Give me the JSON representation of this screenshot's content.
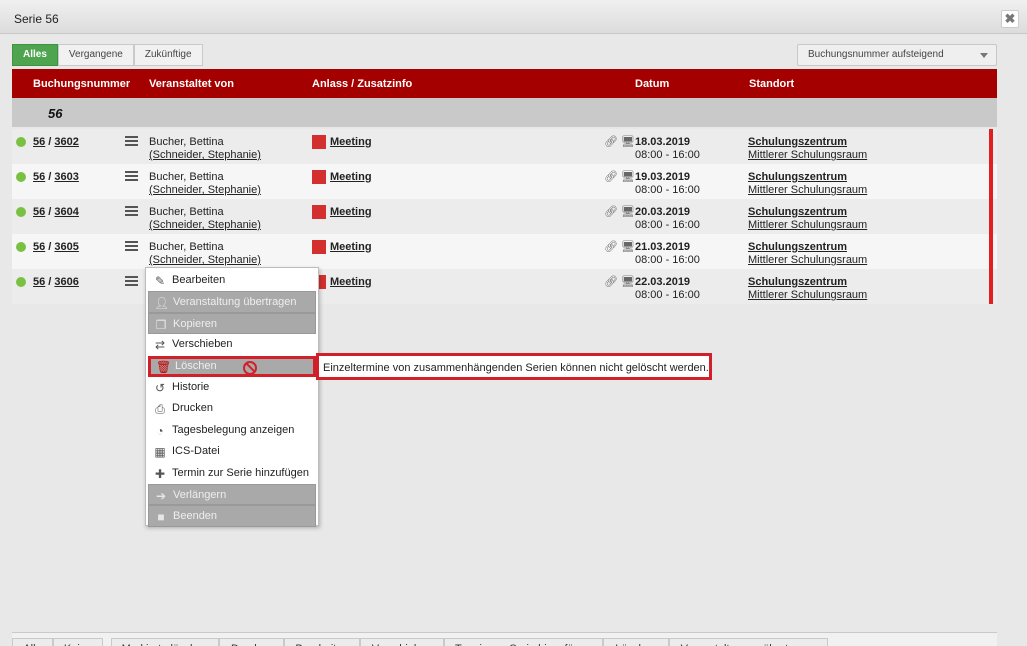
{
  "window": {
    "title": "Serie 56",
    "close_label": "✖"
  },
  "tabs": [
    {
      "label": "Alles"
    },
    {
      "label": "Vergangene"
    },
    {
      "label": "Zukünftige"
    }
  ],
  "sort": {
    "selected": "Buchungsnummer aufsteigend"
  },
  "table": {
    "headers": [
      "Buchungsnummer",
      "Veranstaltet von",
      "Anlass / Zusatzinfo",
      "Datum",
      "Standort"
    ],
    "group_label": "56",
    "rows": [
      {
        "series": "56",
        "num": "3602",
        "organizer": "Bucher, Bettina",
        "organizer_sub": "(Schneider, Stephanie)",
        "event": "Meeting",
        "date": "18.03.2019",
        "time": "08:00 - 16:00",
        "location": "Schulungszentrum",
        "room": "Mittlerer Schulungsraum"
      },
      {
        "series": "56",
        "num": "3603",
        "organizer": "Bucher, Bettina",
        "organizer_sub": "(Schneider, Stephanie)",
        "event": "Meeting",
        "date": "19.03.2019",
        "time": "08:00 - 16:00",
        "location": "Schulungszentrum",
        "room": "Mittlerer Schulungsraum"
      },
      {
        "series": "56",
        "num": "3604",
        "organizer": "Bucher, Bettina",
        "organizer_sub": "(Schneider, Stephanie)",
        "event": "Meeting",
        "date": "20.03.2019",
        "time": "08:00 - 16:00",
        "location": "Schulungszentrum",
        "room": "Mittlerer Schulungsraum"
      },
      {
        "series": "56",
        "num": "3605",
        "organizer": "Bucher, Bettina",
        "organizer_sub": "(Schneider, Stephanie)",
        "event": "Meeting",
        "date": "21.03.2019",
        "time": "08:00 - 16:00",
        "location": "Schulungszentrum",
        "room": "Mittlerer Schulungsraum"
      },
      {
        "series": "56",
        "num": "3606",
        "organizer": "",
        "organizer_sub": "",
        "event": "Meeting",
        "date": "22.03.2019",
        "time": "08:00 - 16:00",
        "location": "Schulungszentrum",
        "room": "Mittlerer Schulungsraum"
      }
    ]
  },
  "context_menu": {
    "items": [
      {
        "label": "Bearbeiten",
        "icon": "pencil-icon",
        "disabled": false
      },
      {
        "label": "Veranstaltung übertragen",
        "icon": "user-add-icon",
        "disabled": true
      },
      {
        "label": "Kopieren",
        "icon": "copy-icon",
        "disabled": true
      },
      {
        "label": "Verschieben",
        "icon": "swap-arrows-icon",
        "disabled": false
      },
      {
        "label": "Löschen",
        "icon": "trash-icon",
        "disabled": true
      },
      {
        "label": "Historie",
        "icon": "history-icon",
        "disabled": false
      },
      {
        "label": "Drucken",
        "icon": "printer-icon",
        "disabled": false
      },
      {
        "label": "Tagesbelegung anzeigen",
        "icon": "pie-chart-icon",
        "disabled": false
      },
      {
        "label": "ICS-Datei",
        "icon": "calendar-icon",
        "disabled": false
      },
      {
        "label": "Termin zur Serie hinzufügen",
        "icon": "plus-icon",
        "disabled": false
      },
      {
        "label": "Verlängern",
        "icon": "arrow-right-icon",
        "disabled": true
      },
      {
        "label": "Beenden",
        "icon": "stop-icon",
        "disabled": true
      }
    ]
  },
  "tooltip": {
    "text": "Einzeltermine von zusammenhängenden Serien können nicht gelöscht werden."
  },
  "footer": {
    "buttons": [
      "Alle",
      "Keine",
      "Markierte löschen",
      "Drucken",
      "Bearbeiten",
      "Verschieben",
      "Termin zur Serie hinzufügen",
      "Löschen",
      "Veranstaltungen übertragen"
    ]
  },
  "colors": {
    "header": "#a50000",
    "active_tab": "#4fa54f",
    "status_dot": "#7ac143",
    "event_square": "#d32f2f",
    "highlight": "#d2202a"
  }
}
